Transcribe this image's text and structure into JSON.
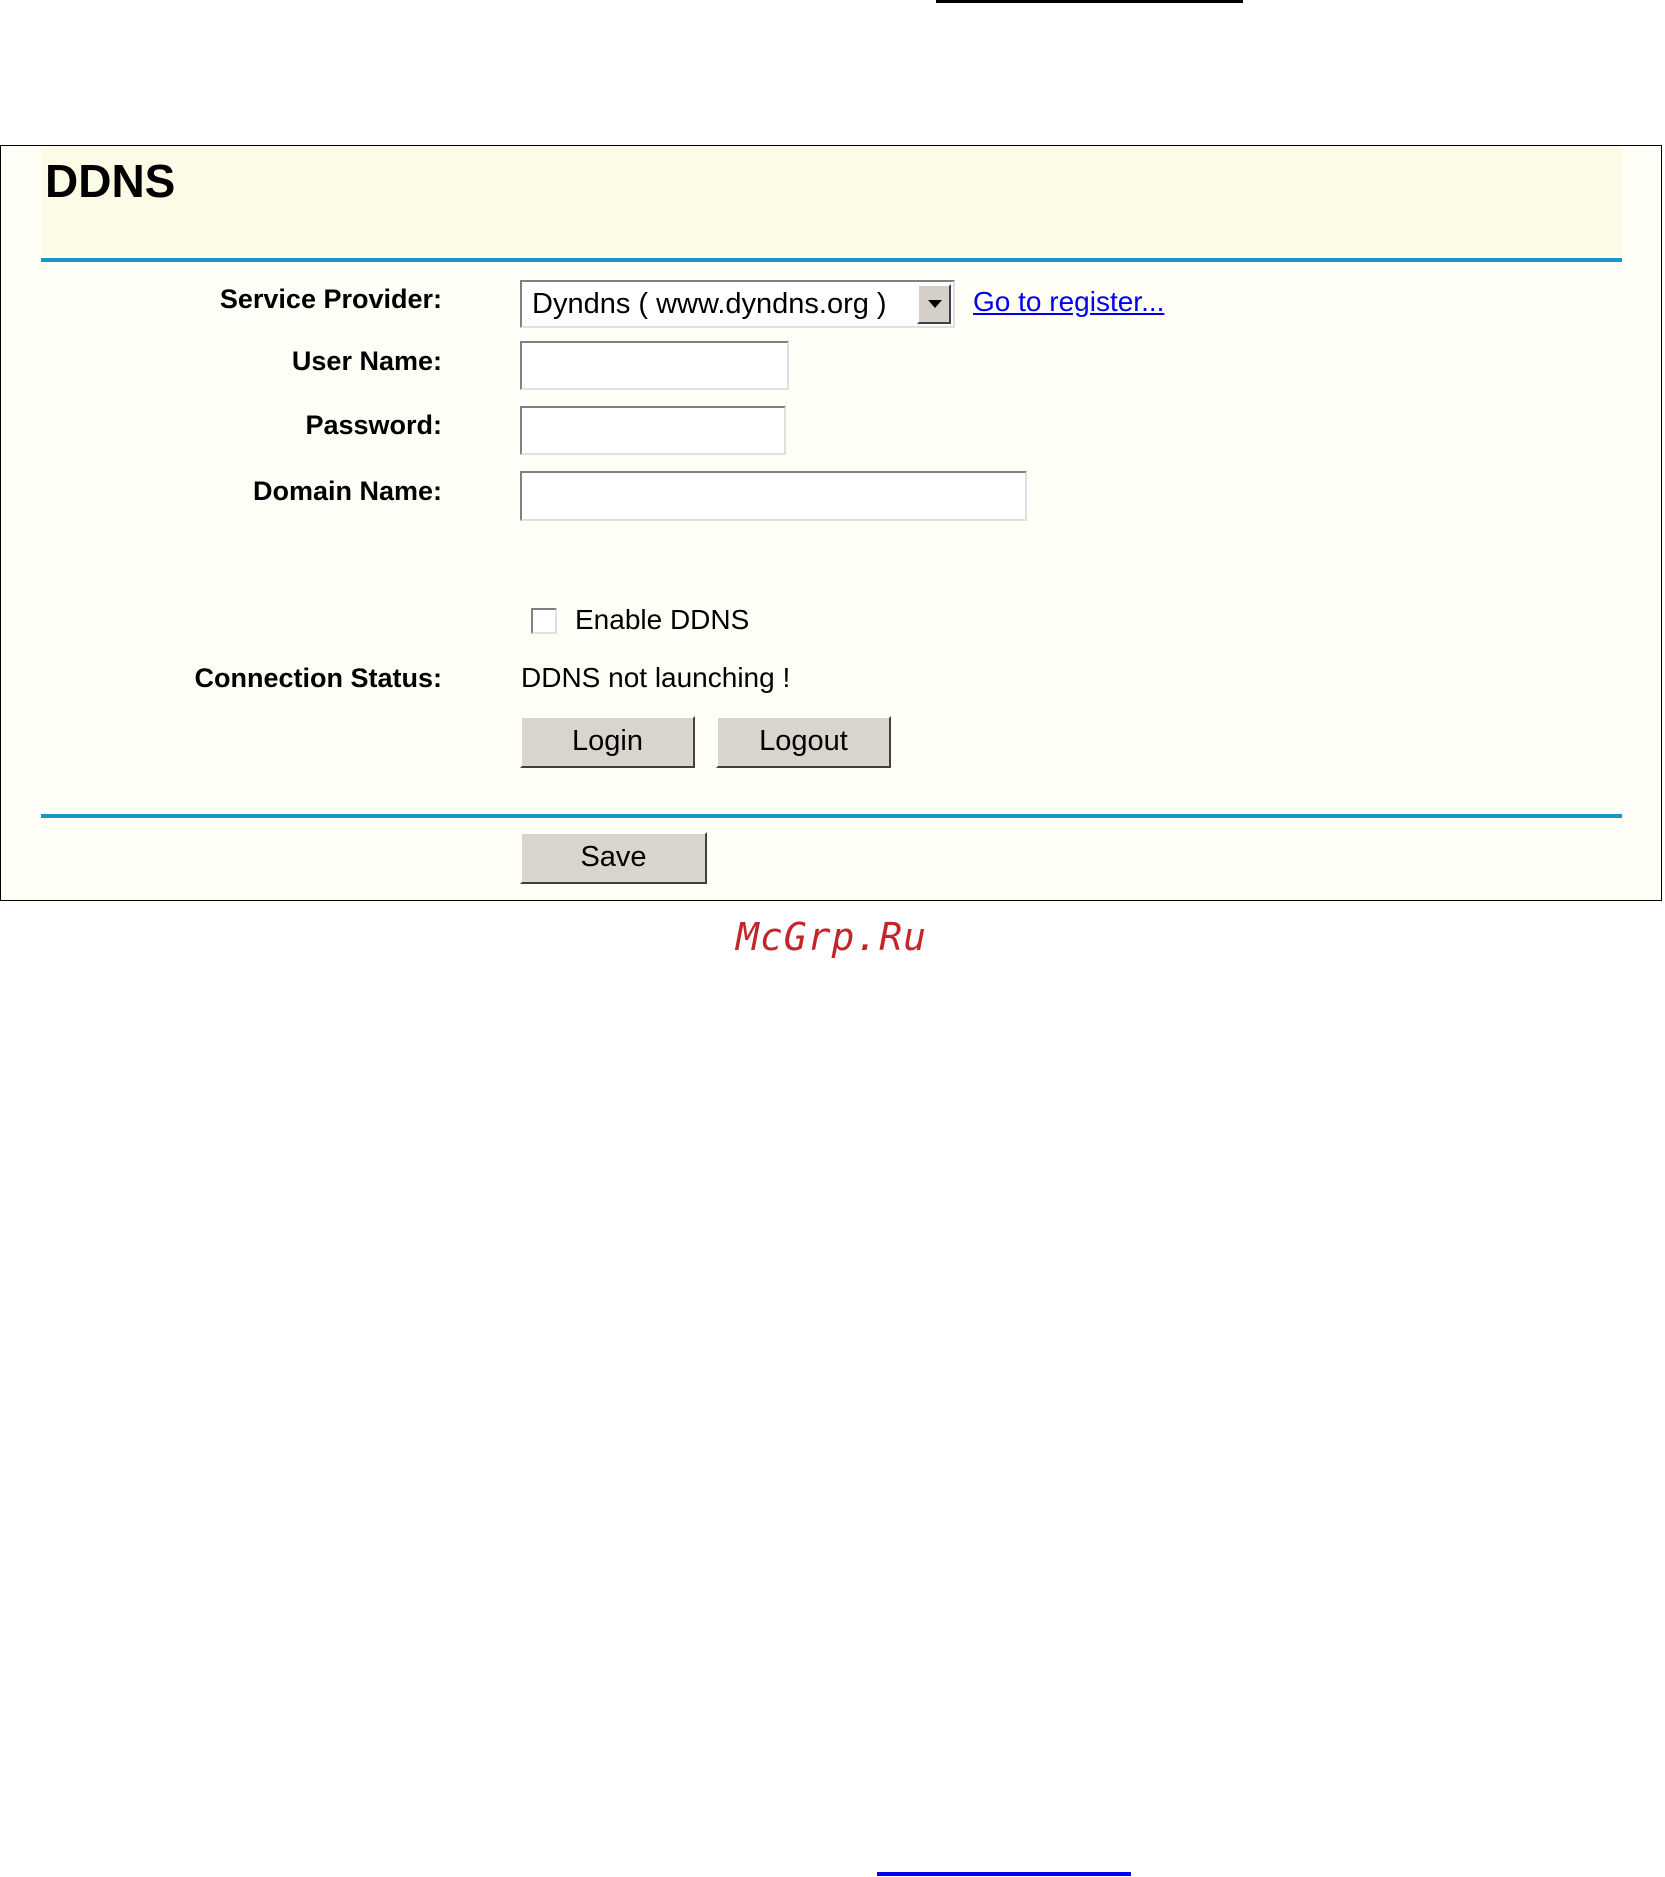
{
  "title": "DDNS",
  "service_provider": {
    "label": "Service Provider:",
    "selected": "Dyndns ( www.dyndns.org )",
    "register_link": "Go to register..."
  },
  "user_name": {
    "label": "User Name:",
    "value": ""
  },
  "password": {
    "label": "Password:",
    "value": ""
  },
  "domain_name": {
    "label": "Domain Name:",
    "value": ""
  },
  "enable_ddns": {
    "label": "Enable DDNS",
    "checked": false
  },
  "connection_status": {
    "label": "Connection Status:",
    "value": "DDNS not launching !"
  },
  "buttons": {
    "login": "Login",
    "logout": "Logout",
    "save": "Save"
  },
  "watermark": "McGrp.Ru",
  "colors": {
    "divider": "#1a96c8",
    "panel_background": "#fffff8",
    "link": "#0000ee",
    "watermark": "#c0262a"
  }
}
